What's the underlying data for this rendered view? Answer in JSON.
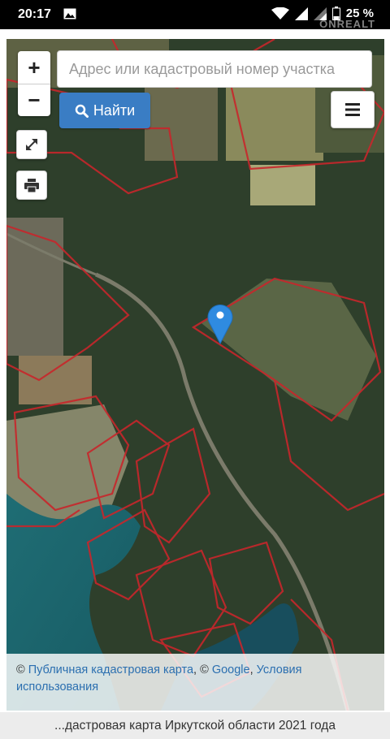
{
  "status_bar": {
    "time": "20:17",
    "battery": "25 %",
    "icons": [
      "image-icon",
      "wifi-icon",
      "signal-icon",
      "signal-icon",
      "battery-icon"
    ]
  },
  "watermark": "ONREALT",
  "map": {
    "search_placeholder": "Адрес или кадастровый номер участка",
    "find_label": "Найти",
    "zoom_in": "+",
    "zoom_out": "−",
    "attribution": {
      "copyright_1": "©",
      "link_1": "Публичная кадастровая карта",
      "separator": ", ©",
      "link_2": "Google",
      "separator_2": ",",
      "link_3": "Условия использования"
    },
    "colors": {
      "parcel_border": "#c8262b",
      "pin": "#2f8be0",
      "find_button": "#3a7dc4"
    }
  },
  "footer": {
    "title": "...дастровая карта Иркутской области 2021 года"
  }
}
